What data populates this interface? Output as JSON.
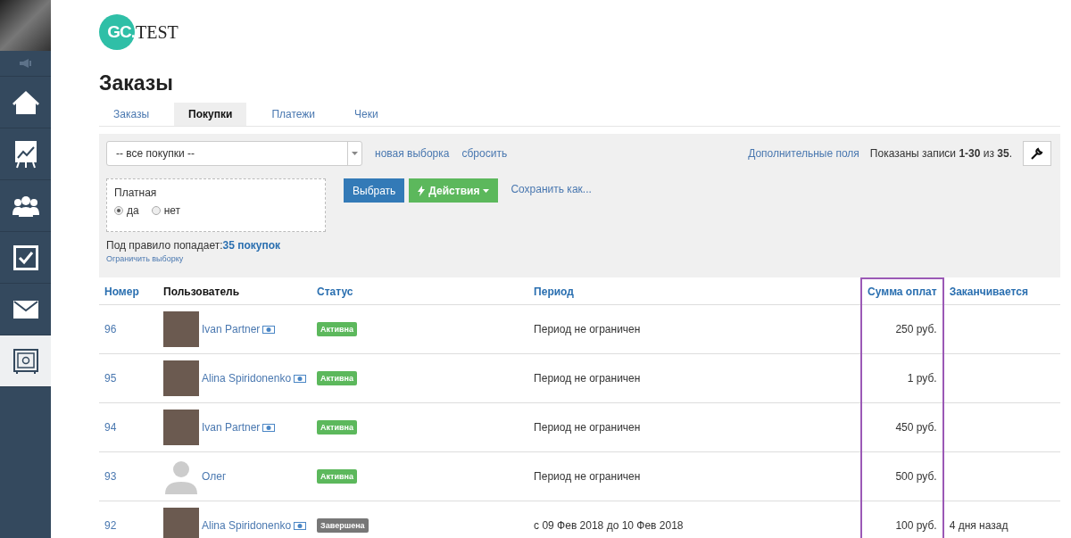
{
  "logo": {
    "mark": "GC.",
    "text": "TEST"
  },
  "title": "Заказы",
  "tabs": [
    {
      "label": "Заказы",
      "selected": false
    },
    {
      "label": "Покупки",
      "selected": true
    },
    {
      "label": "Платежи",
      "selected": false
    },
    {
      "label": "Чеки",
      "selected": false
    }
  ],
  "filter": {
    "select_value": "-- все покупки --",
    "links": [
      "новая выборка",
      "сбросить"
    ],
    "extra_fields": "Дополнительные поля",
    "shown": "Показаны записи **1-30** из **35**.",
    "condition": {
      "label": "Платная",
      "options": [
        {
          "label": "да",
          "selected": true
        },
        {
          "label": "нет",
          "selected": false
        }
      ]
    },
    "buttons": [
      {
        "label": "Выбрать",
        "kind": "primary"
      },
      {
        "label": "Действия",
        "kind": "actions"
      }
    ],
    "save_as": "Сохранить как...",
    "match_label": "Под правило попадает:",
    "match_count": "35 покупок",
    "limit": "Ограничить выборку"
  },
  "table": {
    "columns": [
      {
        "label": "Номер",
        "link": true,
        "highlighted": false
      },
      {
        "label": "Пользователь",
        "link": false,
        "highlighted": false
      },
      {
        "label": "Статус",
        "link": true,
        "highlighted": false
      },
      {
        "label": "Период",
        "link": true,
        "highlighted": false
      },
      {
        "label": "Сумма оплат",
        "link": true,
        "highlighted": true
      },
      {
        "label": "Заканчивается",
        "link": true,
        "highlighted": false
      }
    ],
    "rows": [
      {
        "number": "96",
        "user": "Ivan Partner",
        "has_photo": true,
        "verified": true,
        "status": {
          "label": "Активна",
          "kind": "active"
        },
        "period": "Период не ограничен",
        "sum": "250 руб."
      },
      {
        "number": "95",
        "user": "Alina Spiridonenko",
        "has_photo": true,
        "verified": true,
        "status": {
          "label": "Активна",
          "kind": "active"
        },
        "period": "Период не ограничен",
        "sum": "1 руб."
      },
      {
        "number": "94",
        "user": "Ivan Partner",
        "has_photo": true,
        "verified": true,
        "status": {
          "label": "Активна",
          "kind": "active"
        },
        "period": "Период не ограничен",
        "sum": "450 руб."
      },
      {
        "number": "93",
        "user": "Олег",
        "has_photo": false,
        "verified": false,
        "status": {
          "label": "Активна",
          "kind": "active"
        },
        "period": "Период не ограничен",
        "sum": "500 руб."
      },
      {
        "number": "92",
        "user": "Alina Spiridonenko",
        "has_photo": true,
        "verified": true,
        "status": {
          "label": "Завершена",
          "kind": "completed"
        },
        "period": "с 09 Фев 2018 до 10 Фев 2018",
        "sum": "100 руб.",
        "ends": "4 дня назад"
      }
    ]
  }
}
